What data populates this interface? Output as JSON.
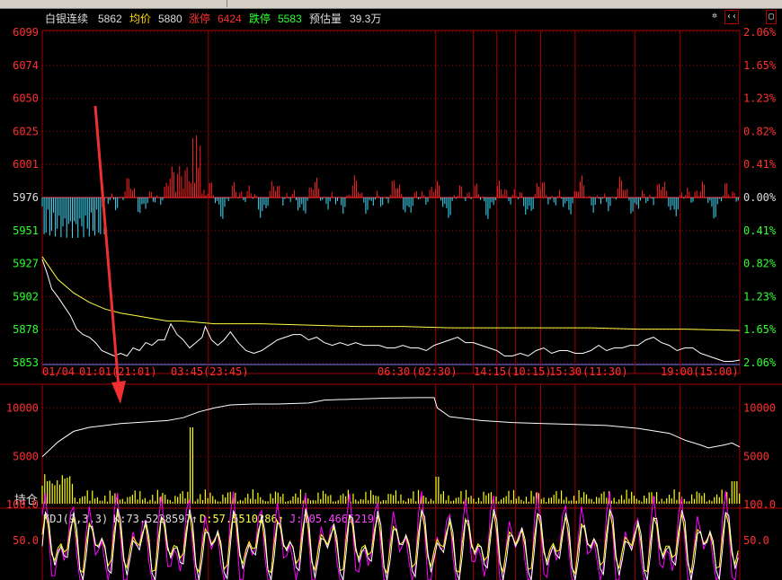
{
  "tabs": [
    "",
    "",
    ""
  ],
  "header": {
    "name": "白银连续",
    "price": "5862",
    "avg_label": "均价",
    "avg_value": "5880",
    "limit_up_label": "涨停",
    "limit_up_value": "6424",
    "limit_down_label": "跌停",
    "limit_down_value": "5583",
    "est_vol_label": "预估量",
    "est_vol_value": "39.3万"
  },
  "colors": {
    "up": "#ff2020",
    "down": "#40e0ff",
    "grid": "#a00000",
    "price": "#ffffff",
    "avg": "#ffff40",
    "volume": "#ffff00",
    "kdj_k": "#ffffff",
    "kdj_d": "#ffff00",
    "kdj_j": "#ff00ff"
  },
  "price_panel": {
    "left_ticks": [
      "6099",
      "6074",
      "6050",
      "6025",
      "6001",
      "5976",
      "5951",
      "5927",
      "5902",
      "5878",
      "5853"
    ],
    "right_ticks": [
      "2.06%",
      "1.65%",
      "1.23%",
      "0.82%",
      "0.41%",
      "0.00%",
      "0.41%",
      "0.82%",
      "1.23%",
      "1.65%",
      "2.06%"
    ],
    "time_labels": [
      "01/04",
      "01:01",
      "(21:01)",
      "03:45",
      "(23:45)",
      "06:30",
      "(02:30)",
      "14:15",
      "(10:15)",
      "15:30",
      "(11:30)",
      "19:00",
      "(15:00)"
    ]
  },
  "oi_panel": {
    "left_ticks": [
      "10000",
      "5000"
    ],
    "right_ticks": [
      "10000",
      "5000"
    ],
    "label": "持仓"
  },
  "kdj_panel": {
    "title": "KDJ(9,3,3)",
    "k_label": "K:73.5228597",
    "d_label": "D:57.5510286",
    "j_label": "J:105.4665219",
    "left_ticks": [
      "100.0",
      "50.0"
    ],
    "right_ticks": [
      "100.0",
      "50.0"
    ]
  },
  "chart_data": {
    "type": "line",
    "title": "",
    "ylim": [
      5853,
      6099
    ],
    "prev_settle": 5976,
    "price_series": [
      [
        0,
        5930
      ],
      [
        3,
        5920
      ],
      [
        6,
        5908
      ],
      [
        10,
        5902
      ],
      [
        14,
        5895
      ],
      [
        18,
        5888
      ],
      [
        22,
        5878
      ],
      [
        26,
        5874
      ],
      [
        30,
        5872
      ],
      [
        34,
        5868
      ],
      [
        38,
        5862
      ],
      [
        42,
        5860
      ],
      [
        46,
        5858
      ],
      [
        50,
        5860
      ],
      [
        54,
        5858
      ],
      [
        58,
        5864
      ],
      [
        62,
        5862
      ],
      [
        66,
        5868
      ],
      [
        70,
        5866
      ],
      [
        74,
        5870
      ],
      [
        78,
        5870
      ],
      [
        82,
        5882
      ],
      [
        86,
        5874
      ],
      [
        90,
        5870
      ],
      [
        94,
        5864
      ],
      [
        98,
        5868
      ],
      [
        102,
        5872
      ],
      [
        104,
        5880
      ],
      [
        108,
        5870
      ],
      [
        112,
        5866
      ],
      [
        116,
        5870
      ],
      [
        120,
        5876
      ],
      [
        125,
        5868
      ],
      [
        130,
        5862
      ],
      [
        135,
        5860
      ],
      [
        140,
        5862
      ],
      [
        145,
        5866
      ],
      [
        150,
        5870
      ],
      [
        155,
        5872
      ],
      [
        160,
        5874
      ],
      [
        165,
        5874
      ],
      [
        170,
        5870
      ],
      [
        175,
        5872
      ],
      [
        180,
        5868
      ],
      [
        185,
        5866
      ],
      [
        190,
        5868
      ],
      [
        195,
        5866
      ],
      [
        200,
        5868
      ],
      [
        205,
        5866
      ],
      [
        210,
        5866
      ],
      [
        215,
        5866
      ],
      [
        220,
        5864
      ],
      [
        225,
        5864
      ],
      [
        230,
        5866
      ],
      [
        235,
        5864
      ],
      [
        240,
        5864
      ],
      [
        245,
        5862
      ],
      [
        250,
        5866
      ],
      [
        255,
        5868
      ],
      [
        260,
        5870
      ],
      [
        265,
        5872
      ],
      [
        270,
        5868
      ],
      [
        275,
        5868
      ],
      [
        280,
        5866
      ],
      [
        285,
        5864
      ],
      [
        290,
        5862
      ],
      [
        295,
        5858
      ],
      [
        300,
        5858
      ],
      [
        305,
        5860
      ],
      [
        310,
        5858
      ],
      [
        315,
        5862
      ],
      [
        320,
        5864
      ],
      [
        325,
        5860
      ],
      [
        330,
        5862
      ],
      [
        335,
        5862
      ],
      [
        340,
        5860
      ],
      [
        345,
        5860
      ],
      [
        350,
        5862
      ],
      [
        355,
        5866
      ],
      [
        360,
        5862
      ],
      [
        365,
        5864
      ],
      [
        370,
        5864
      ],
      [
        375,
        5866
      ],
      [
        380,
        5866
      ],
      [
        385,
        5870
      ],
      [
        390,
        5872
      ],
      [
        395,
        5868
      ],
      [
        400,
        5866
      ],
      [
        405,
        5862
      ],
      [
        410,
        5864
      ],
      [
        415,
        5864
      ],
      [
        420,
        5860
      ],
      [
        425,
        5858
      ],
      [
        430,
        5856
      ],
      [
        435,
        5854
      ],
      [
        440,
        5854
      ],
      [
        445,
        5855
      ]
    ],
    "avg_series": [
      [
        0,
        5932
      ],
      [
        10,
        5915
      ],
      [
        20,
        5905
      ],
      [
        30,
        5898
      ],
      [
        40,
        5893
      ],
      [
        50,
        5890
      ],
      [
        60,
        5888
      ],
      [
        70,
        5886
      ],
      [
        80,
        5884
      ],
      [
        90,
        5884
      ],
      [
        110,
        5882
      ],
      [
        140,
        5882
      ],
      [
        170,
        5881
      ],
      [
        200,
        5880
      ],
      [
        230,
        5880
      ],
      [
        260,
        5879
      ],
      [
        290,
        5879
      ],
      [
        320,
        5879
      ],
      [
        350,
        5879
      ],
      [
        380,
        5878
      ],
      [
        410,
        5878
      ],
      [
        445,
        5877
      ]
    ],
    "open_interest": [
      [
        0,
        5000
      ],
      [
        10,
        6500
      ],
      [
        20,
        7600
      ],
      [
        30,
        8000
      ],
      [
        40,
        8200
      ],
      [
        50,
        8400
      ],
      [
        60,
        8500
      ],
      [
        70,
        8600
      ],
      [
        80,
        8700
      ],
      [
        90,
        9000
      ],
      [
        100,
        9600
      ],
      [
        110,
        10000
      ],
      [
        120,
        10300
      ],
      [
        135,
        10400
      ],
      [
        150,
        10400
      ],
      [
        170,
        10500
      ],
      [
        180,
        10800
      ],
      [
        200,
        10900
      ],
      [
        220,
        11000
      ],
      [
        240,
        11050
      ],
      [
        250,
        11050
      ],
      [
        252,
        10000
      ],
      [
        260,
        9100
      ],
      [
        280,
        8700
      ],
      [
        300,
        8500
      ],
      [
        320,
        8400
      ],
      [
        340,
        8300
      ],
      [
        360,
        8200
      ],
      [
        380,
        7900
      ],
      [
        400,
        7400
      ],
      [
        410,
        6700
      ],
      [
        420,
        6200
      ],
      [
        425,
        5900
      ],
      [
        435,
        6200
      ],
      [
        440,
        6400
      ],
      [
        445,
        6000
      ]
    ],
    "vertical_markers": [
      0,
      106,
      251,
      275,
      290,
      302,
      318,
      340,
      378,
      407
    ],
    "total_points": 445
  }
}
